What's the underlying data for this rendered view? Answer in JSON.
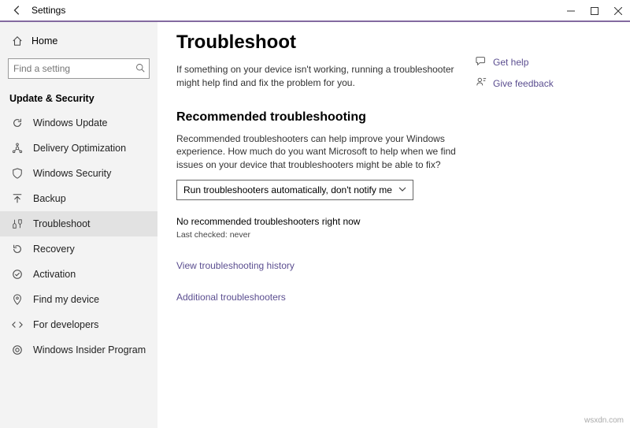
{
  "titlebar": {
    "title": "Settings"
  },
  "sidebar": {
    "home": "Home",
    "search_placeholder": "Find a setting",
    "section": "Update & Security",
    "items": [
      {
        "label": "Windows Update"
      },
      {
        "label": "Delivery Optimization"
      },
      {
        "label": "Windows Security"
      },
      {
        "label": "Backup"
      },
      {
        "label": "Troubleshoot"
      },
      {
        "label": "Recovery"
      },
      {
        "label": "Activation"
      },
      {
        "label": "Find my device"
      },
      {
        "label": "For developers"
      },
      {
        "label": "Windows Insider Program"
      }
    ]
  },
  "main": {
    "title": "Troubleshoot",
    "intro": "If something on your device isn't working, running a troubleshooter might help find and fix the problem for you.",
    "rec_heading": "Recommended troubleshooting",
    "rec_desc": "Recommended troubleshooters can help improve your Windows experience. How much do you want Microsoft to help when we find issues on your device that troubleshooters might be able to fix?",
    "dropdown_value": "Run troubleshooters automatically, don't notify me",
    "status": "No recommended troubleshooters right now",
    "last_checked": "Last checked: never",
    "history_link": "View troubleshooting history",
    "additional_link": "Additional troubleshooters"
  },
  "aside": {
    "get_help": "Get help",
    "give_feedback": "Give feedback"
  },
  "watermark": "wsxdn.com"
}
